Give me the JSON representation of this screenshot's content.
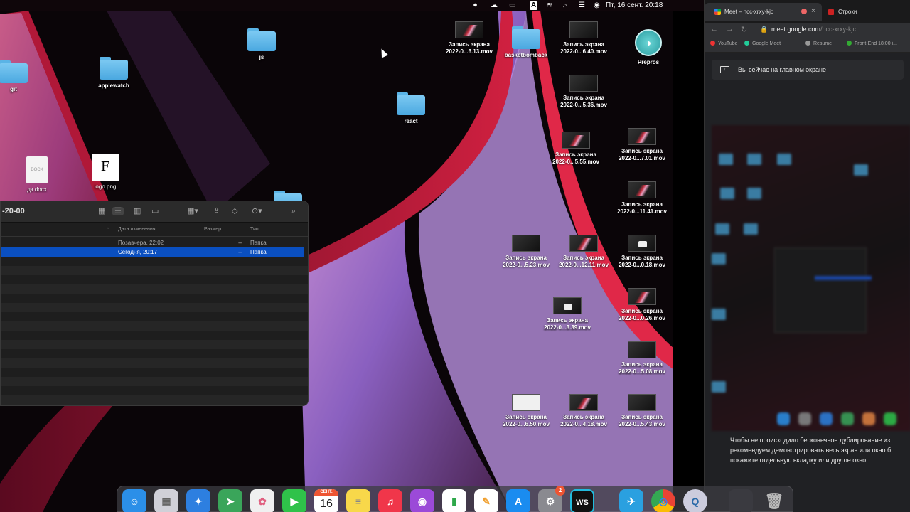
{
  "menubar": {
    "datetime": "Пт, 16 сент.  20:18",
    "icons": [
      "record-icon",
      "creative-cloud-icon",
      "battery-icon",
      "keyboard-layout-icon",
      "wifi-icon",
      "search-icon",
      "control-center-icon",
      "siri-icon"
    ],
    "keyboard_layout": "A"
  },
  "desktop": {
    "folders": [
      {
        "name": "git"
      },
      {
        "name": "applewatch"
      },
      {
        "name": "js"
      },
      {
        "name": "react"
      },
      {
        "name": "basketbomback"
      }
    ],
    "files": [
      {
        "name": "дз.docx",
        "icon_text": "DOCX"
      },
      {
        "name": "logo.png",
        "icon_text": "F"
      }
    ],
    "apps": [
      {
        "name": "Prepros"
      }
    ],
    "recordings": [
      {
        "line1": "Запись экрана",
        "line2": "2022-0...6.13.mov",
        "thumb": "red"
      },
      {
        "line1": "Запись экрана",
        "line2": "2022-0...6.40.mov",
        "thumb": "dark"
      },
      {
        "line1": "Запись экрана",
        "line2": "2022-0...5.36.mov",
        "thumb": "dark"
      },
      {
        "line1": "Запись экрана",
        "line2": "2022-0...5.55.mov",
        "thumb": "red"
      },
      {
        "line1": "Запись экрана",
        "line2": "2022-0...7.01.mov",
        "thumb": "red"
      },
      {
        "line1": "Запись экрана",
        "line2": "2022-0...11.41.mov",
        "thumb": "red"
      },
      {
        "line1": "Запись экрана",
        "line2": "2022-0...5.23.mov",
        "thumb": "dark"
      },
      {
        "line1": "Запись экрана",
        "line2": "2022-0...12.11.mov",
        "thumb": "red"
      },
      {
        "line1": "Запись экрана",
        "line2": "2022-0...0.18.mov",
        "thumb": "white"
      },
      {
        "line1": "Запись экрана",
        "line2": "2022-0...3.39.mov",
        "thumb": "white"
      },
      {
        "line1": "Запись экрана",
        "line2": "2022-0...0.26.mov",
        "thumb": "red"
      },
      {
        "line1": "Запись экрана",
        "line2": "2022-0...5.08.mov",
        "thumb": "dark"
      },
      {
        "line1": "Запись экрана",
        "line2": "2022-0...6.50.mov",
        "thumb": "doc"
      },
      {
        "line1": "Запись экрана",
        "line2": "2022-0...4.18.mov",
        "thumb": "red"
      },
      {
        "line1": "Запись экрана",
        "line2": "2022-0...5.43.mov",
        "thumb": "dark"
      }
    ]
  },
  "finder": {
    "title": "-20-00",
    "columns": {
      "modified": "Дата изменения",
      "size": "Размер",
      "kind": "Тип"
    },
    "rows": [
      {
        "modified": "Позавчера, 22:02",
        "size": "--",
        "kind": "Папка",
        "selected": false
      },
      {
        "modified": "Сегодня, 20:17",
        "size": "--",
        "kind": "Папка",
        "selected": true
      }
    ]
  },
  "chrome": {
    "tabs": [
      {
        "label": "Meet – ncc-xrxy-kjc",
        "active": true
      },
      {
        "label": "Строки",
        "active": false
      }
    ],
    "url_host": "meet.google.com",
    "url_path": "/ncc-xrxy-kjc",
    "bookmarks": [
      {
        "label": "YouTube",
        "color": "#e33"
      },
      {
        "label": "Google Meet",
        "color": "#2c9"
      },
      {
        "label": "Resume",
        "color": "#999"
      },
      {
        "label": "Front-End 18:00 i...",
        "color": "#3a3"
      }
    ],
    "banner_text": "Вы сейчас на главном экране",
    "message_lines": [
      "Чтобы не происходило бесконечное дублирование из",
      "рекомендуем демонстрировать весь экран или окно б",
      "покажите отдельную вкладку или другое окно."
    ]
  },
  "dock": {
    "apps": [
      {
        "name": "finder-icon",
        "glyph": "☺",
        "color": "#2b8fe8"
      },
      {
        "name": "launchpad-icon",
        "glyph": "▦",
        "color": "#d0d0d8"
      },
      {
        "name": "safari-icon",
        "glyph": "✦",
        "color": "#2d7fe0"
      },
      {
        "name": "maps-icon",
        "glyph": "➤",
        "color": "#3aa55a"
      },
      {
        "name": "photos-icon",
        "glyph": "✿",
        "color": "#f0f0f0"
      },
      {
        "name": "facetime-icon",
        "glyph": "▶",
        "color": "#2fc24a"
      },
      {
        "name": "calendar-icon",
        "glyph": "16",
        "color": "#ffffff",
        "month": "СЕНТ."
      },
      {
        "name": "notes-icon",
        "glyph": "≡",
        "color": "#f8d84a"
      },
      {
        "name": "music-icon",
        "glyph": "♫",
        "color": "#f0364a"
      },
      {
        "name": "podcasts-icon",
        "glyph": "◉",
        "color": "#9b4ad8"
      },
      {
        "name": "numbers-icon",
        "glyph": "▮",
        "color": "#2ea84a"
      },
      {
        "name": "pages-icon",
        "glyph": "✎",
        "color": "#f0a030"
      },
      {
        "name": "app-store-icon",
        "glyph": "A",
        "color": "#1a8cf0"
      },
      {
        "name": "system-preferences-icon",
        "glyph": "⚙",
        "color": "#8a8a90",
        "badge": "2"
      },
      {
        "name": "webstorm-icon",
        "glyph": "WS",
        "color": "#1a1a1a"
      },
      {
        "name": "telegram-icon",
        "glyph": "✈",
        "color": "#2aa0e0"
      },
      {
        "name": "chrome-icon",
        "glyph": "◎",
        "color": "#e8e8e8"
      },
      {
        "name": "quicktime-icon",
        "glyph": "Q",
        "color": "#4a90c8"
      },
      {
        "name": "downloads-icon",
        "glyph": "",
        "color": "#3a3a40"
      },
      {
        "name": "trash-icon",
        "glyph": "🗑",
        "color": "#55555a"
      }
    ]
  }
}
